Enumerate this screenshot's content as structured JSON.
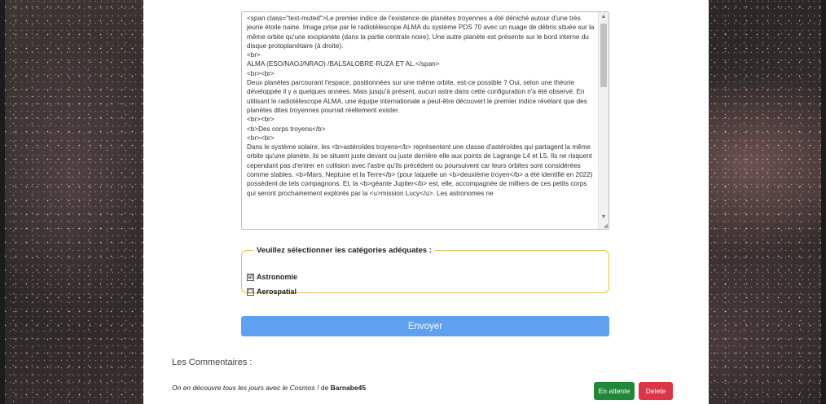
{
  "editor": {
    "content": "<span class=\"text-muted\">Le premier indice de l'existence de planètes troyennes a été déniché autour d'une très jeune étoile naine. Image prise par le radiotélescope ALMA du système PDS 70 avec un nuage de débris située sur la même orbite qu'une exoplanète (dans la partie centrale noire). Une autre planète est présente sur le bord interne du disque protoplanétaire (à droite).\n<br>\nALMA (ESO/NAOJ/NRAO) /BALSALOBRE-RUZA ET AL.</span>\n<br><br>\nDeux planètes parcourant l'espace, positionnées sur une même orbite, est-ce possible ? Oui, selon une théorie développée il y a quelques années. Mais jusqu'à présent, aucun astre dans cette configuration n'a été observé. En utilisant le radiotélescope ALMA, une équipe internationale a peut-être découvert le premier indice révélant que des planètes dites troyennes pourrait réellement exister.\n<br><br>\n<b>Des corps troyens</b>\n<br><br>\nDans le système solaire, les <b>astéroïdes troyens</b> représentent une classe d'astéroïdes qui partagent la même orbite qu'une planète, ils se situent juste devant ou juste derrière elle aux points de Lagrange L4 et L5. Ils ne risquent cependant pas d'entrer en collision avec l'astre qu'ils précèdent ou poursuivent car leurs orbites sont considérées comme stables. <b>Mars, Neptune et la Terre</b> (pour laquelle un <b>deuxième troyen</b> a été identifié en 2022) possèdent de tels compagnons. Et, la <b>géante Jupiter</b> est, elle, accompagnée de milliers de ces petits corps qui seront prochainement explorés par la <u>mission Lucy</u>. Les astronomes ne"
  },
  "categories": {
    "legend": "Veuillez sélectionner les catégories adéquates :",
    "items": [
      {
        "label": "Astronomie",
        "checked": true,
        "mark": "☑"
      },
      {
        "label": "Aerospatial",
        "checked": false,
        "mark": "☐"
      }
    ]
  },
  "form": {
    "submit_label": "Envoyer"
  },
  "comments": {
    "title": "Les Commentaires :",
    "items": [
      {
        "text": "On en découvre tous les jours avec le Cosmos !",
        "by": " de ",
        "author": "Barnabe45",
        "pending_label": "En attente",
        "delete_label": "Delete"
      }
    ]
  },
  "colors": {
    "submit": "#5fa0f0",
    "pending": "#218838",
    "delete": "#dc3545",
    "fieldset_border": "#f0c419"
  }
}
